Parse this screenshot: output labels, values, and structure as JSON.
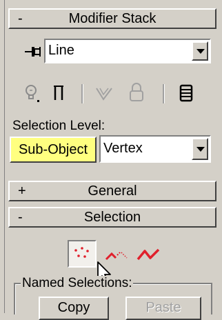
{
  "rollouts": {
    "modifier_stack": {
      "sign": "-",
      "title": "Modifier Stack"
    },
    "general": {
      "sign": "+",
      "title": "General"
    },
    "selection": {
      "sign": "-",
      "title": "Selection"
    }
  },
  "modifier_stack": {
    "pin_icon": "pin-icon",
    "dropdown_value": "Line",
    "toolbar_icons": [
      "lightbulb-icon",
      "pipe-icon",
      "modifier-icon",
      "lock-icon",
      "stack-icon"
    ],
    "selection_level_label": "Selection Level:",
    "subobject_button": "Sub-Object",
    "subobject_highlight": "#ffff80",
    "level_value": "Vertex"
  },
  "selection": {
    "mode_icons": [
      "vertex-mode-icon",
      "segment-mode-icon",
      "spline-mode-icon"
    ],
    "accent_color": "#e0202c",
    "named_selections_label": "Named Selections:",
    "copy_button": "Copy",
    "paste_button": "Paste"
  }
}
